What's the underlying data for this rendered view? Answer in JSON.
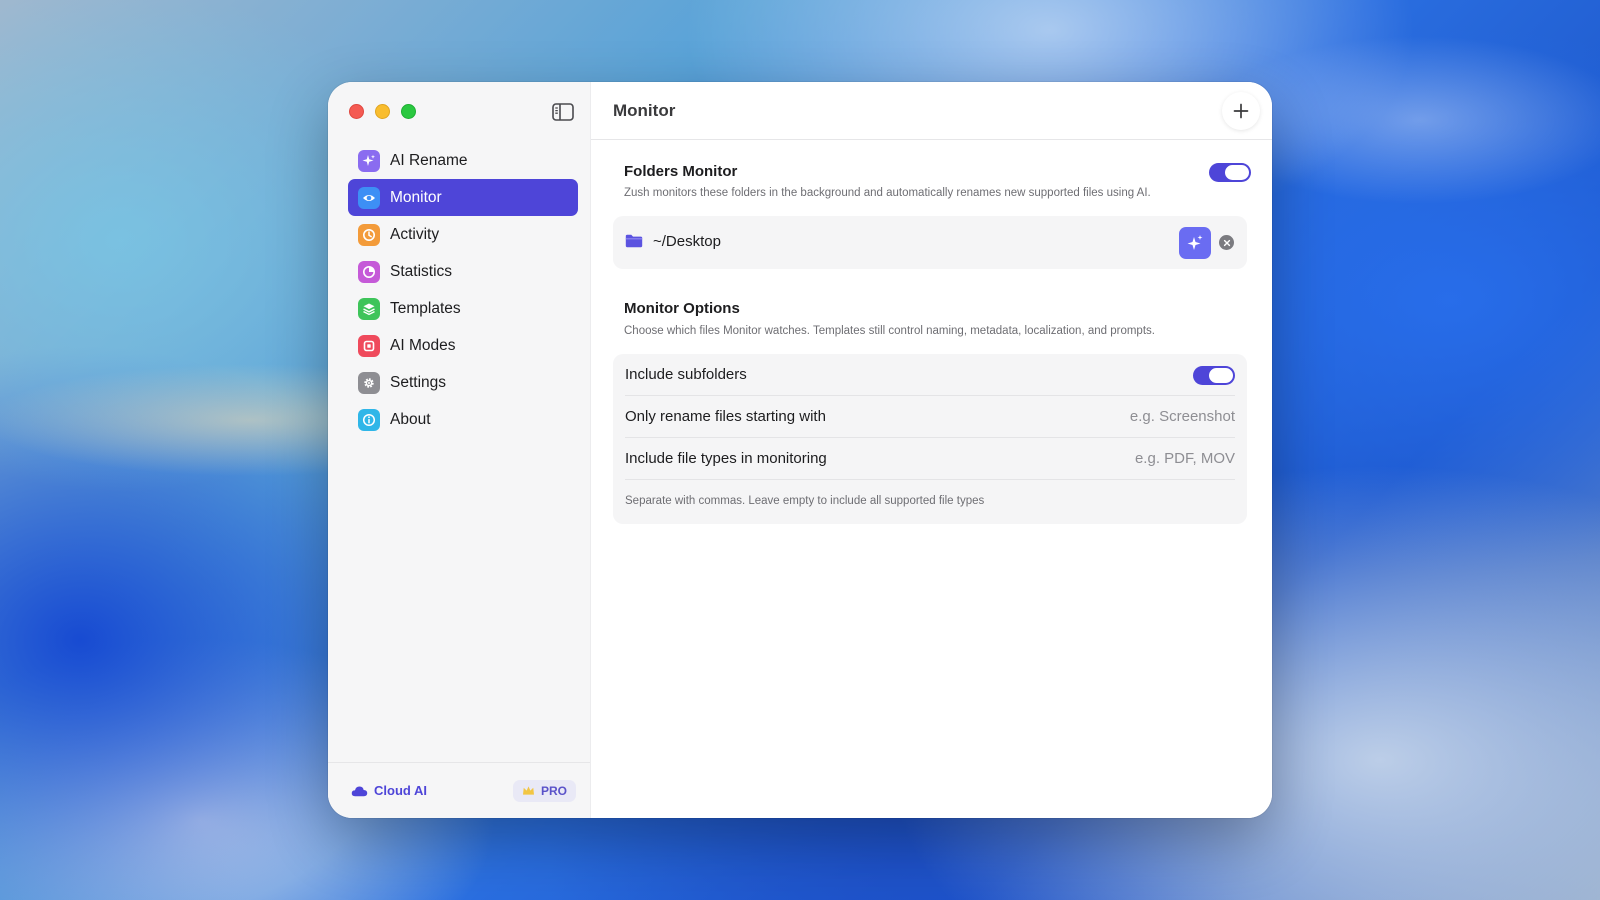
{
  "window": {
    "title": "Monitor"
  },
  "sidebar": {
    "items": [
      {
        "label": "AI Rename",
        "icon": "sparkles-icon",
        "color": "#8a6cf0",
        "active": false
      },
      {
        "label": "Monitor",
        "icon": "eye-icon",
        "color": "#3d8ff5",
        "active": true
      },
      {
        "label": "Activity",
        "icon": "clock-icon",
        "color": "#f39b3a",
        "active": false
      },
      {
        "label": "Statistics",
        "icon": "pie-chart-icon",
        "color": "#c55ad8",
        "active": false
      },
      {
        "label": "Templates",
        "icon": "stack-icon",
        "color": "#3ec45a",
        "active": false
      },
      {
        "label": "AI Modes",
        "icon": "square-icon",
        "color": "#ef4a5c",
        "active": false
      },
      {
        "label": "Settings",
        "icon": "gear-icon",
        "color": "#8e8e93",
        "active": false
      },
      {
        "label": "About",
        "icon": "info-icon",
        "color": "#2fb6e8",
        "active": false
      }
    ],
    "footer": {
      "cloud_label": "Cloud AI",
      "pro_label": "PRO"
    }
  },
  "folders_monitor": {
    "title": "Folders Monitor",
    "description": "Zush monitors these folders in the background and automatically renames new supported files using AI.",
    "enabled": true,
    "folders": [
      {
        "path": "~/Desktop"
      }
    ]
  },
  "monitor_options": {
    "title": "Monitor Options",
    "description": "Choose which files Monitor watches. Templates still control naming, metadata, localization, and prompts.",
    "include_subfolders": {
      "label": "Include subfolders",
      "enabled": true
    },
    "prefix_filter": {
      "label": "Only rename files starting with",
      "placeholder": "e.g. Screenshot"
    },
    "file_types": {
      "label": "Include file types in monitoring",
      "placeholder": "e.g. PDF, MOV"
    },
    "hint": "Separate with commas. Leave empty to include all supported file types"
  },
  "colors": {
    "accent": "#4e45d8",
    "sparkle_button": "#6a6cf2"
  }
}
